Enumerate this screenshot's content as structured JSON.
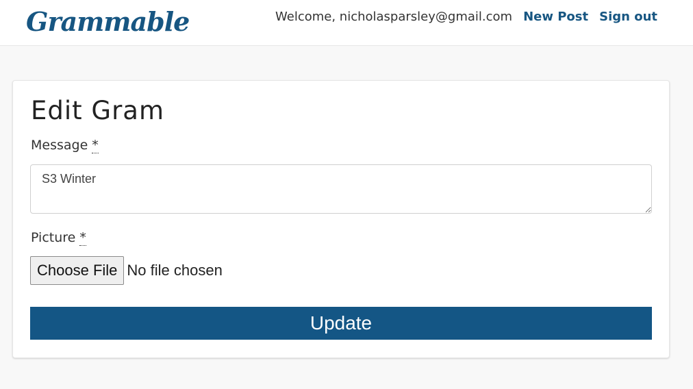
{
  "header": {
    "brand": "Grammable",
    "welcome_text": "Welcome, nicholasparsley@gmail.com",
    "links": {
      "new_post": "New Post",
      "sign_out": "Sign out"
    }
  },
  "form": {
    "title": "Edit Gram",
    "message": {
      "label": "Message",
      "required_marker": "*",
      "value": "S3 Winter"
    },
    "picture": {
      "label": "Picture",
      "required_marker": "*",
      "button_label": "Choose File",
      "status": "No file chosen"
    },
    "submit_label": "Update"
  },
  "colors": {
    "brand": "#175682",
    "button": "#145685",
    "background": "#f8f8f8"
  }
}
